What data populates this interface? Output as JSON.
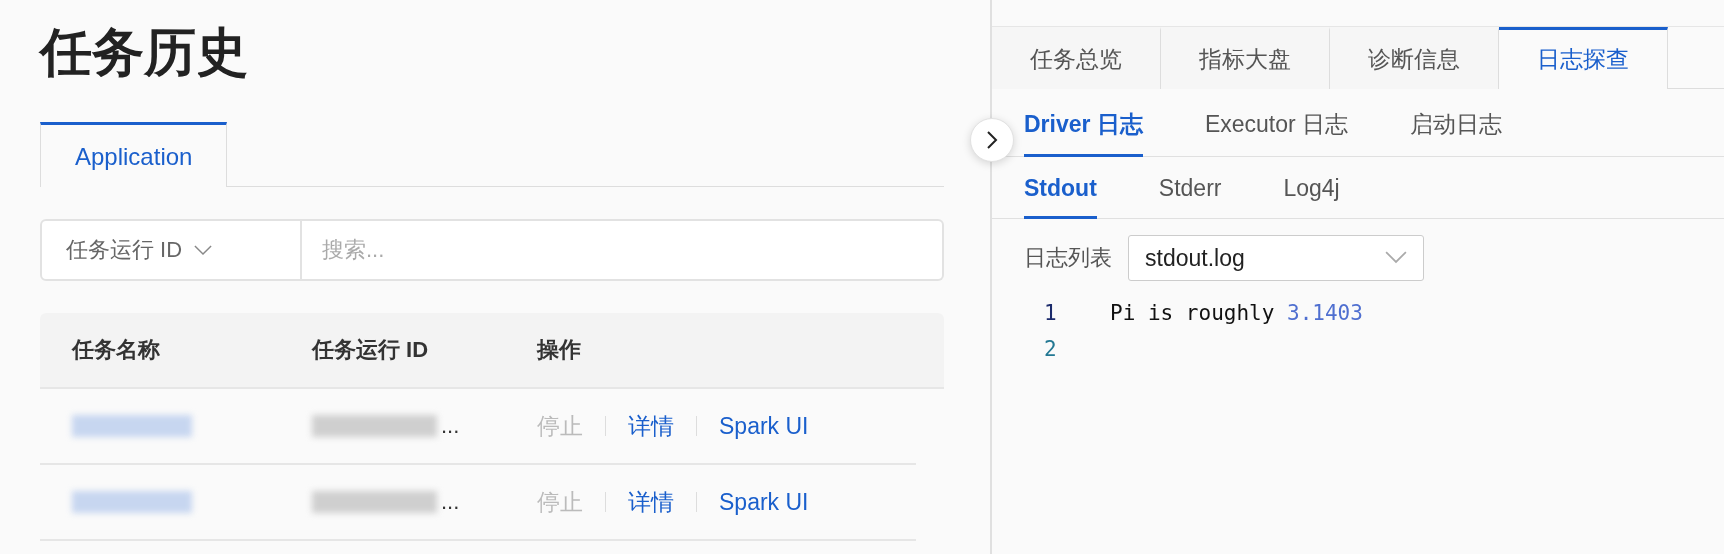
{
  "page_title": "任务历史",
  "left_tabs": [
    {
      "label": "Application",
      "selected": true
    }
  ],
  "search": {
    "filter": "任务运行 ID",
    "placeholder": "搜索..."
  },
  "table": {
    "columns": [
      "任务名称",
      "任务运行 ID",
      "操作"
    ],
    "rows": [
      {
        "name_redacted": true,
        "id_suffix": "...",
        "actions": [
          {
            "label": "停止",
            "disabled": true
          },
          {
            "label": "详情",
            "disabled": false
          },
          {
            "label": "Spark UI",
            "disabled": false
          }
        ]
      },
      {
        "name_redacted": true,
        "id_suffix": "...",
        "actions": [
          {
            "label": "停止",
            "disabled": true
          },
          {
            "label": "详情",
            "disabled": false
          },
          {
            "label": "Spark UI",
            "disabled": false
          }
        ]
      }
    ]
  },
  "right_tabs": [
    {
      "label": "任务总览",
      "selected": false
    },
    {
      "label": "指标大盘",
      "selected": false
    },
    {
      "label": "诊断信息",
      "selected": false
    },
    {
      "label": "日志探查",
      "selected": true
    }
  ],
  "log_tabs": [
    {
      "label": "Driver 日志",
      "selected": true
    },
    {
      "label": "Executor 日志",
      "selected": false
    },
    {
      "label": "启动日志",
      "selected": false
    }
  ],
  "stream_tabs": [
    {
      "label": "Stdout",
      "selected": true
    },
    {
      "label": "Stderr",
      "selected": false
    },
    {
      "label": "Log4j",
      "selected": false
    }
  ],
  "log_list": {
    "label": "日志列表",
    "value": "stdout.log"
  },
  "log_lines": [
    {
      "number": "1",
      "tokens": [
        {
          "kind": "text",
          "text": "Pi is roughly "
        },
        {
          "kind": "number",
          "text": "3.1403"
        }
      ]
    },
    {
      "number": "2"
    }
  ]
}
